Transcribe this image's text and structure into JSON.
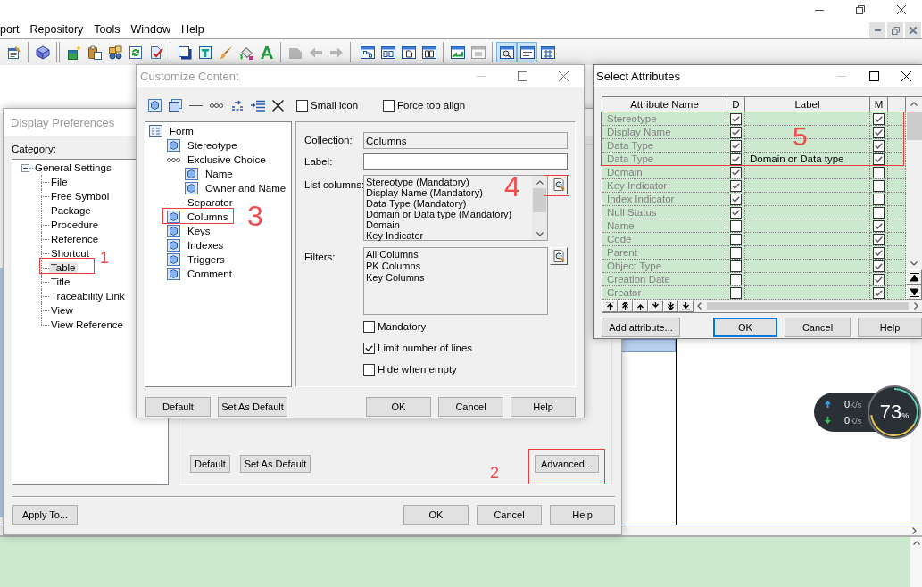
{
  "menu": [
    "port",
    "Repository",
    "Tools",
    "Window",
    "Help"
  ],
  "toolbar": [
    {
      "kind": "properties",
      "on": false,
      "disabled": false
    },
    {
      "kind": "separator"
    },
    {
      "kind": "help",
      "on": false,
      "disabled": false
    },
    {
      "kind": "break"
    },
    {
      "kind": "new",
      "on": false,
      "disabled": false
    },
    {
      "kind": "paste",
      "on": false,
      "disabled": false
    },
    {
      "kind": "find",
      "on": false,
      "disabled": false
    },
    {
      "kind": "refresh",
      "on": false,
      "disabled": false
    },
    {
      "kind": "check",
      "on": false,
      "disabled": false
    },
    {
      "kind": "separator"
    },
    {
      "kind": "shape",
      "on": false,
      "disabled": false
    },
    {
      "kind": "text",
      "on": false,
      "disabled": false
    },
    {
      "kind": "brush",
      "on": false,
      "disabled": false
    },
    {
      "kind": "fill",
      "on": false,
      "disabled": false
    },
    {
      "kind": "font",
      "on": false,
      "disabled": false
    },
    {
      "kind": "separator"
    },
    {
      "kind": "symbol",
      "on": false,
      "disabled": true
    },
    {
      "kind": "back",
      "on": false,
      "disabled": true
    },
    {
      "kind": "forward",
      "on": false,
      "disabled": true
    },
    {
      "kind": "break"
    },
    {
      "kind": "diagram",
      "on": false,
      "disabled": false
    },
    {
      "kind": "layout",
      "on": false,
      "disabled": false
    },
    {
      "kind": "page",
      "on": false,
      "disabled": false
    },
    {
      "kind": "pages",
      "on": false,
      "disabled": false
    },
    {
      "kind": "separator"
    },
    {
      "kind": "link",
      "on": false,
      "disabled": false
    },
    {
      "kind": "window",
      "on": false,
      "disabled": true
    },
    {
      "kind": "separator"
    },
    {
      "kind": "preview",
      "on": true,
      "disabled": false
    },
    {
      "kind": "note",
      "on": true,
      "disabled": false
    },
    {
      "kind": "grid",
      "on": false,
      "disabled": false
    }
  ],
  "display_preferences": {
    "title": "Display Preferences",
    "active": false,
    "category_label": "Category:",
    "tree": {
      "label": "General Settings",
      "expanded": true,
      "selected": false,
      "children": [
        {
          "label": "File",
          "selected": false
        },
        {
          "label": "Free Symbol",
          "selected": false
        },
        {
          "label": "Package",
          "selected": false
        },
        {
          "label": "Procedure",
          "selected": false
        },
        {
          "label": "Reference",
          "selected": false
        },
        {
          "label": "Shortcut",
          "selected": false
        },
        {
          "label": "Table",
          "selected": true
        },
        {
          "label": "Title",
          "selected": false
        },
        {
          "label": "Traceability Link",
          "selected": false
        },
        {
          "label": "View",
          "selected": false
        },
        {
          "label": "View Reference",
          "selected": false
        }
      ]
    },
    "panel_buttons": [
      "Default",
      "Set As Default",
      "Advanced..."
    ],
    "apply_button": "Apply To...",
    "buttons": [
      "OK",
      "Cancel",
      "Help"
    ]
  },
  "customize_content": {
    "title": "Customize Content",
    "active": false,
    "options": [
      {
        "label": "Small icon",
        "checked": false
      },
      {
        "label": "Force top align",
        "checked": false
      }
    ],
    "tree": {
      "kind": "form",
      "label": "Form",
      "children": [
        {
          "kind": "attribute",
          "label": "Stereotype"
        },
        {
          "kind": "choice",
          "label": "Exclusive Choice",
          "children": [
            {
              "kind": "attribute",
              "label": "Name"
            },
            {
              "kind": "attribute",
              "label": "Owner and Name"
            }
          ]
        },
        {
          "kind": "separator",
          "label": "Separator"
        },
        {
          "kind": "attribute",
          "label": "Columns"
        },
        {
          "kind": "attribute",
          "label": "Keys"
        },
        {
          "kind": "attribute",
          "label": "Indexes"
        },
        {
          "kind": "attribute",
          "label": "Triggers"
        },
        {
          "kind": "attribute",
          "label": "Comment"
        }
      ]
    },
    "collection": {
      "label": "Collection:",
      "value": "Columns"
    },
    "label_field": {
      "label": "Label:"
    },
    "list_columns": {
      "label": "List columns:",
      "items": [
        "Stereotype (Mandatory)",
        "Display Name (Mandatory)",
        "Data Type (Mandatory)",
        "Domain or Data type (Mandatory)",
        "Domain",
        "Key Indicator"
      ]
    },
    "filters": {
      "label": "Filters:",
      "items": [
        "All Columns",
        "PK Columns",
        "Key Columns"
      ]
    },
    "flags": [
      {
        "label": "Mandatory",
        "checked": false
      },
      {
        "label": "Limit number of lines",
        "checked": true
      },
      {
        "label": "Hide when empty",
        "checked": false
      }
    ],
    "left_buttons": [
      "Default",
      "Set As Default"
    ],
    "buttons": [
      "OK",
      "Cancel",
      "Help"
    ]
  },
  "select_attributes": {
    "title": "Select Attributes",
    "active": true,
    "columns": [
      "Attribute Name",
      "D",
      "Label",
      "M"
    ],
    "rows": [
      {
        "name": "Stereotype",
        "d": true,
        "m": true
      },
      {
        "name": "Display Name",
        "d": true,
        "m": true
      },
      {
        "name": "Data Type",
        "d": true,
        "m": true
      },
      {
        "name": "Data Type",
        "d": true,
        "label": "Domain or Data type",
        "m": true
      },
      {
        "name": "Domain",
        "d": true,
        "m": false
      },
      {
        "name": "Key Indicator",
        "d": true,
        "m": false
      },
      {
        "name": "Index Indicator",
        "d": true,
        "m": false
      },
      {
        "name": "Null Status",
        "d": true,
        "m": false
      },
      {
        "name": "Name",
        "d": false,
        "m": true
      },
      {
        "name": "Code",
        "d": false,
        "m": true
      },
      {
        "name": "Parent",
        "d": false,
        "m": true
      },
      {
        "name": "Object Type",
        "d": false,
        "m": true
      },
      {
        "name": "Creation Date",
        "d": false,
        "m": true
      },
      {
        "name": "Creator",
        "d": false,
        "m": true
      }
    ],
    "add_button": "Add attribute...",
    "buttons": [
      {
        "label": "OK",
        "focused": true
      },
      {
        "label": "Cancel",
        "focused": false
      },
      {
        "label": "Help",
        "focused": false
      }
    ]
  },
  "network_monitor": {
    "upload": {
      "value": "0",
      "unit": "K/s"
    },
    "download": {
      "value": "0",
      "unit": "K/s"
    },
    "load": {
      "value": "73",
      "unit": "%"
    }
  },
  "annotations": [
    "1",
    "2",
    "3",
    "4",
    "5"
  ]
}
